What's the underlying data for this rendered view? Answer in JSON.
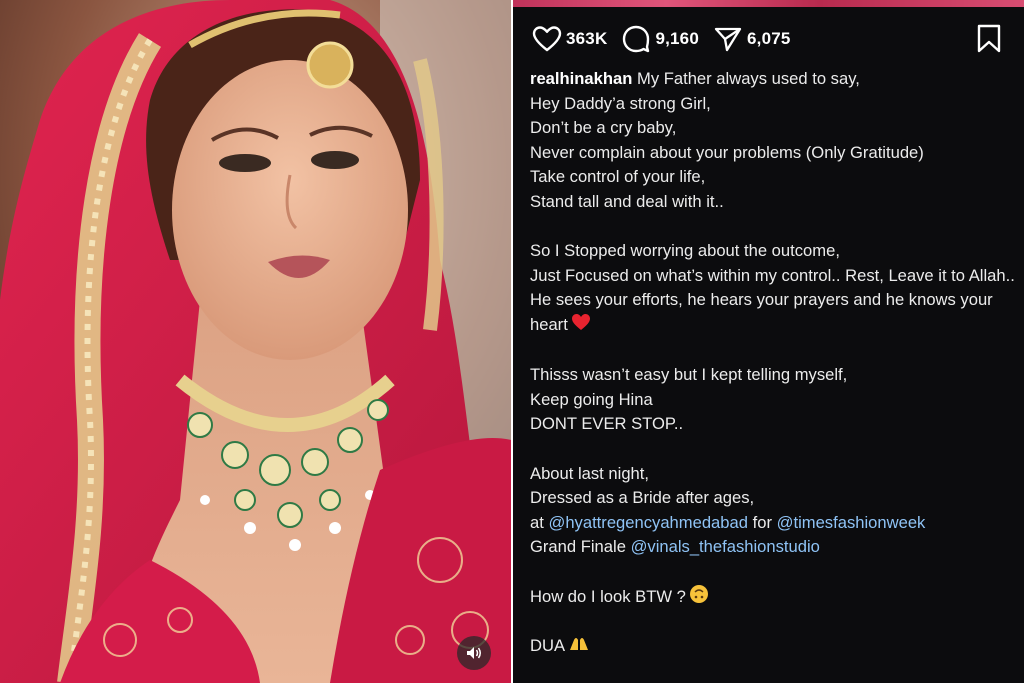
{
  "photo": {
    "description_icon": "bride-photo",
    "sound_icon": "speaker-icon"
  },
  "post": {
    "likes": "363K",
    "comments": "9,160",
    "shares": "6,075",
    "username": "realhinakhan",
    "caption_first": "My Father always used to say,",
    "lines": [
      "Hey Daddy’a strong Girl,",
      "Don’t be a cry baby,",
      "Never complain about your problems (Only Gratitude)",
      "Take control of your life,",
      "Stand tall and deal with it.."
    ],
    "para2": [
      "So I Stopped worrying about the outcome,",
      "Just Focused on what’s within my control.. Rest, Leave it to Allah..",
      "He sees your efforts, he hears your prayers and he knows your heart"
    ],
    "para3": [
      "Thisss wasn’t easy but I kept telling myself,",
      "Keep going Hina",
      "DONT EVER STOP.."
    ],
    "para4": {
      "line1": "About last night,",
      "line2": "Dressed as a Bride after ages,",
      "at": "at",
      "mention1": "@hyattregencyahmedabad",
      "for": "for",
      "mention2": "@timesfashionweek",
      "grand": "Grand Finale",
      "mention3": "@vinals_thefashionstudio"
    },
    "question": "How do I look BTW ?",
    "dua": "DUA"
  },
  "colors": {
    "background": "#0c0c0e",
    "mention": "#8fc3f5",
    "heart_emoji": "#e8232f",
    "dress_red": "#d41c4a"
  }
}
